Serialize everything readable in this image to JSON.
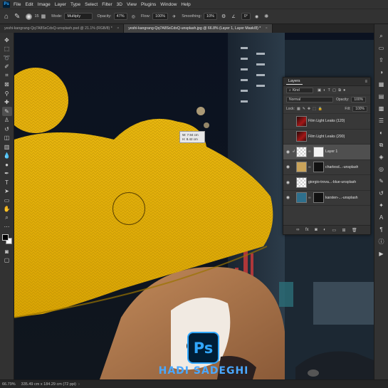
{
  "menubar": {
    "app_icon": "Ps",
    "items": [
      "File",
      "Edit",
      "Image",
      "Layer",
      "Type",
      "Select",
      "Filter",
      "3D",
      "View",
      "Plugins",
      "Window",
      "Help"
    ]
  },
  "options": {
    "brush_size": "15",
    "mode_label": "Mode:",
    "mode_value": "Multiply",
    "opacity_label": "Opacity:",
    "opacity_value": "47%",
    "flow_label": "Flow:",
    "flow_value": "100%",
    "smoothing_label": "Smoothing:",
    "smoothing_value": "10%",
    "angle_value": "0°"
  },
  "tabs": [
    {
      "label": "yeshi-kangrang-Qq7A8SsCdxQ-unsplash.psd @ 21.1% (RGB/8) *",
      "active": false
    },
    {
      "label": "yeshi-kangrang-Qq7A8SsCdxQ-unsplash.jpg @ 66.8% (Layer 1, Layer Mask/8) *",
      "active": true
    }
  ],
  "canvas": {
    "measure_line1": "W: 7.94 cm",
    "measure_line2": "H: 8.42 cm"
  },
  "layers_panel": {
    "title": "Layers",
    "filter_kind": "Kind",
    "blend_mode": "Normal",
    "opacity_label": "Opacity:",
    "opacity_value": "100%",
    "lock_label": "Lock:",
    "fill_label": "Fill:",
    "fill_value": "100%",
    "layers": [
      {
        "name": "Film Light Leaks (120)",
        "visible": false,
        "selected": false
      },
      {
        "name": "Film Light Leaks (290)",
        "visible": false,
        "selected": false
      },
      {
        "name": "Layer 1",
        "visible": true,
        "selected": true
      },
      {
        "name": "charlesd...-unsplash",
        "visible": true,
        "selected": false
      },
      {
        "name": "giorgio-trova...-blue-unsplash",
        "visible": true,
        "selected": false
      },
      {
        "name": "karsten-...-unsplash",
        "visible": true,
        "selected": false
      }
    ]
  },
  "watermark": {
    "badge": "Ps",
    "name": "HADI SADEGHI"
  },
  "status": {
    "zoom": "66.79%",
    "doc_size": "335.49 cm x 184.29 cm (72 ppi)"
  }
}
